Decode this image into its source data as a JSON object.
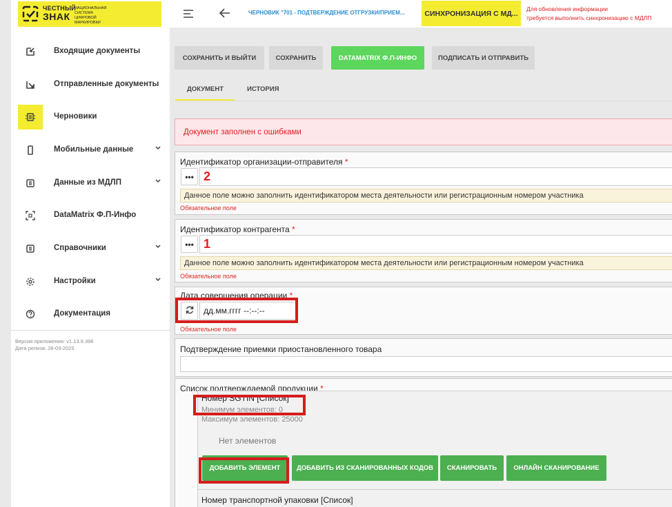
{
  "sidebar": {
    "logo": {
      "word1": "ЧЕСТНЫЙ",
      "word2": "ЗНАК",
      "subtitle": "национальная система цифровой маркировки",
      "color": "#f4ec30"
    },
    "items": [
      {
        "label": "Входящие документы",
        "icon": "inbox-arrow-icon"
      },
      {
        "label": "Отправленные документы",
        "icon": "outbox-arrow-icon"
      },
      {
        "label": "Черновики",
        "icon": "drafts-icon",
        "active": true
      },
      {
        "label": "Мобильные данные",
        "icon": "mobile-icon",
        "expandable": true
      },
      {
        "label": "Данные из МДЛП",
        "icon": "data-list-icon",
        "expandable": true
      },
      {
        "label": "DataMatrix Ф.П-Инфо",
        "icon": "scan-icon"
      },
      {
        "label": "Справочники",
        "icon": "reference-book-icon",
        "expandable": true
      },
      {
        "label": "Настройки",
        "icon": "gear-icon",
        "expandable": true
      },
      {
        "label": "Документация",
        "icon": "help-icon"
      }
    ],
    "version": "Версия приложения: v1.13.9.398",
    "release": "Дата релиза: 28-03-2025"
  },
  "header": {
    "title": "ЧЕРНОВИК \"701 - ПОДТВЕРЖДЕНИЕ ОТГРУЗКИ/ПРИЕМ...",
    "sync_button": "СИНХРОНИЗАЦИЯ С МД...",
    "sync_note_line1": "Для обновления информации",
    "sync_note_line2": "требуется выполнить синхронизацию с МДЛП"
  },
  "toolbar": {
    "save_exit": "СОХРАНИТЬ И ВЫЙТИ",
    "save": "СОХРАНИТЬ",
    "datamatrix": "DATAMATRIX Ф.П-ИНФО",
    "sign_send": "ПОДПИСАТЬ И ОТПРАВИТЬ"
  },
  "tabs": {
    "document": "ДОКУМЕНТ",
    "history": "ИСТОРИЯ"
  },
  "error_banner": "Документ заполнен с ошибками",
  "fields": {
    "sender": {
      "label": "Идентификатор организации-отправителя",
      "required_mark": "*",
      "dots": "•••",
      "annotation": "2",
      "hint": "Данное поле можно заполнить идентификатором места деятельности или регистрационным номером участника",
      "required_note": "Обязательное поле"
    },
    "counterparty": {
      "label": "Идентификатор контрагента",
      "required_mark": "*",
      "dots": "•••",
      "annotation": "1",
      "hint": "Данное поле можно заполнить идентификатором места деятельности или регистрационным номером участника",
      "required_note": "Обязательное поле"
    },
    "operation_date": {
      "label": "Дата совершения операции",
      "required_mark": "*",
      "placeholder": "дд.мм.гггг --:--:--",
      "required_note": "Обязательное поле"
    },
    "suspended_confirm": {
      "label": "Подтверждение приемки приостановленного товара"
    },
    "product_list": {
      "label": "Список подтверждаемой продукции",
      "required_mark": "*",
      "sgtin_title": "Номер SGTIN [Список]",
      "min_elements": "Минимум элементов: 0",
      "max_elements": "Максимум элементов: 25000",
      "empty": "Нет элементов",
      "buttons": {
        "add": "ДОБАВИТЬ ЭЛЕМЕНТ",
        "add_scanned": "ДОБАВИТЬ ИЗ СКАНИРОВАННЫХ КОДОВ",
        "scan": "СКАНИРОВАТЬ",
        "online_scan": "ОНЛАЙН СКАНИРОВАНИЕ"
      },
      "transport_title": "Номер транспортной упаковки [Список]"
    }
  },
  "colors": {
    "accent_yellow": "#f4ec30",
    "green": "#4caf50",
    "error_red": "#e02020",
    "annotation_red": "#d51c1c"
  }
}
